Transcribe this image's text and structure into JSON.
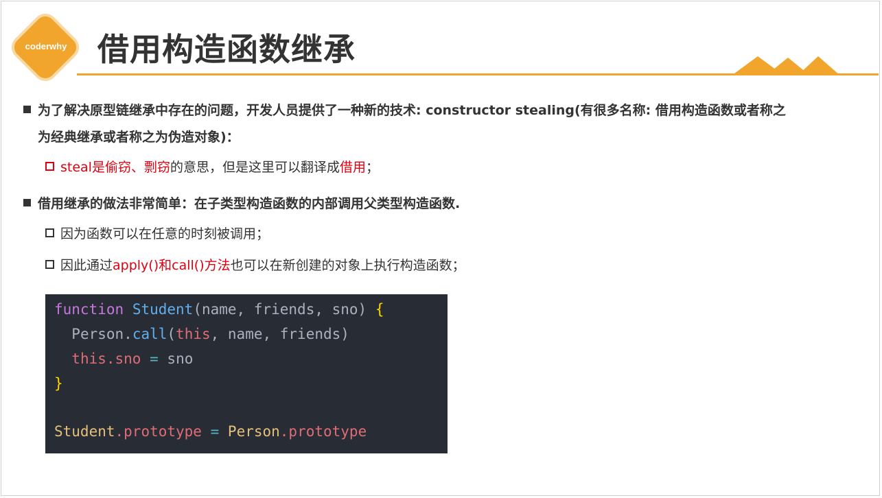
{
  "logo": {
    "text": "coderwhy"
  },
  "title": "借用构造函数继承",
  "bullet1": {
    "line1": "为了解决原型链继承中存在的问题，开发人员提供了一种新的技术: constructor stealing(有很多名称: 借用构造函数或者称之",
    "line2": "为经典继承或者称之为伪造对象)：",
    "sub": {
      "red": "steal是偷窃、剽窃",
      "mid": "的意思，但是这里可以翻译成",
      "red2": "借用",
      "end": "；"
    }
  },
  "bullet2": {
    "text": "借用继承的做法非常简单：在子类型构造函数的内部调用父类型构造函数.",
    "sub1": "因为函数可以在任意的时刻被调用；",
    "sub2": {
      "pre": "因此通过",
      "red": "apply()和call()方法",
      "post": "也可以在新创建的对象上执行构造函数；"
    }
  },
  "code": {
    "l1": {
      "kw": "function",
      "fn": "Student",
      "params": "(name, friends, sno)",
      "brace": "{"
    },
    "l2": {
      "obj": "Person",
      "dot": ".",
      "method": "call",
      "open": "(",
      "this": "this",
      "rest": ", name, friends)"
    },
    "l3": {
      "this": "this",
      "prop": ".sno",
      "op": "=",
      "val": "sno"
    },
    "l4": "}",
    "l6": {
      "obj1": "Student",
      "prop1": ".prototype",
      "op": "=",
      "obj2": "Person",
      "prop2": ".prototype"
    }
  }
}
